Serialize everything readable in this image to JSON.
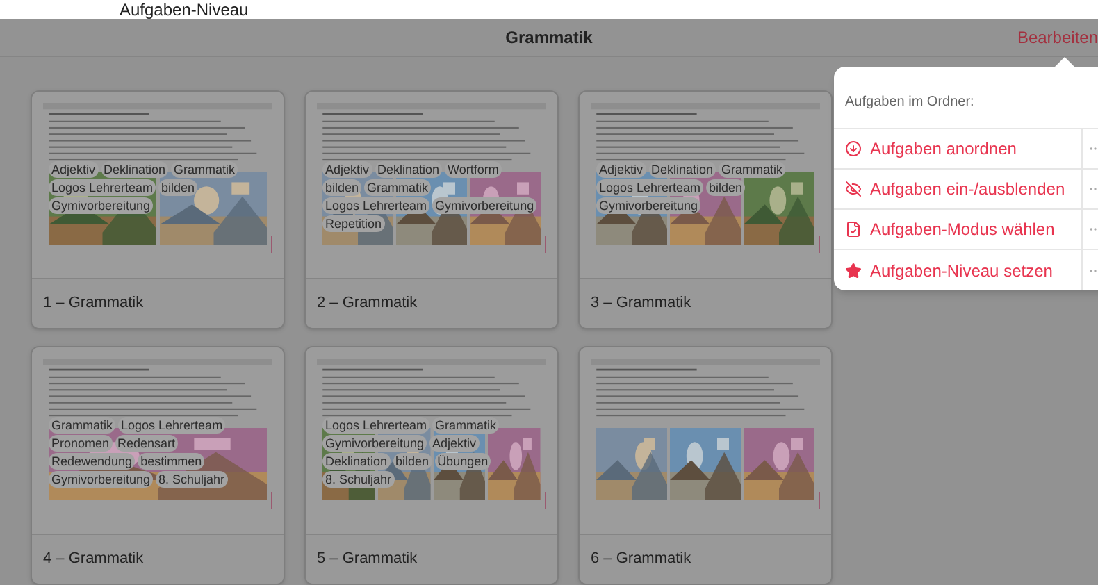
{
  "top_heading": "Aufgaben-Niveau",
  "header": {
    "title": "Grammatik",
    "edit_button": "Bearbeiten"
  },
  "cards": [
    {
      "label": "1 – Grammatik",
      "tags": [
        "Adjektiv",
        "Deklination",
        "Grammatik",
        "Logos Lehrerteam",
        "bilden",
        "Gymivorbereitung"
      ]
    },
    {
      "label": "2 – Grammatik",
      "tags": [
        "Adjektiv",
        "Deklination",
        "Wortform",
        "bilden",
        "Grammatik",
        "Logos Lehrerteam",
        "Gymivorbereitung",
        "Repetition"
      ]
    },
    {
      "label": "3 – Grammatik",
      "tags": [
        "Adjektiv",
        "Deklination",
        "Grammatik",
        "Logos Lehrerteam",
        "bilden",
        "Gymivorbereitung"
      ]
    },
    {
      "label": "4 – Grammatik",
      "tags": [
        "Grammatik",
        "Logos Lehrerteam",
        "Pronomen",
        "Redensart",
        "Redewendung",
        "bestimmen",
        "Gymivorbereitung",
        "8. Schuljahr"
      ]
    },
    {
      "label": "5 – Grammatik",
      "tags": [
        "Logos Lehrerteam",
        "Grammatik",
        "Gymivorbereitung",
        "Adjektiv",
        "Deklination",
        "bilden",
        "Übungen",
        "8. Schuljahr"
      ]
    },
    {
      "label": "6 – Grammatik"
    }
  ],
  "popover": {
    "heading": "Aufgaben im Ordner:",
    "items": [
      {
        "label": "Aufgaben anordnen"
      },
      {
        "label": "Aufgaben ein-/ausblenden"
      },
      {
        "label": "Aufgaben-Modus wählen"
      },
      {
        "label": "Aufgaben-Niveau setzen"
      }
    ]
  }
}
